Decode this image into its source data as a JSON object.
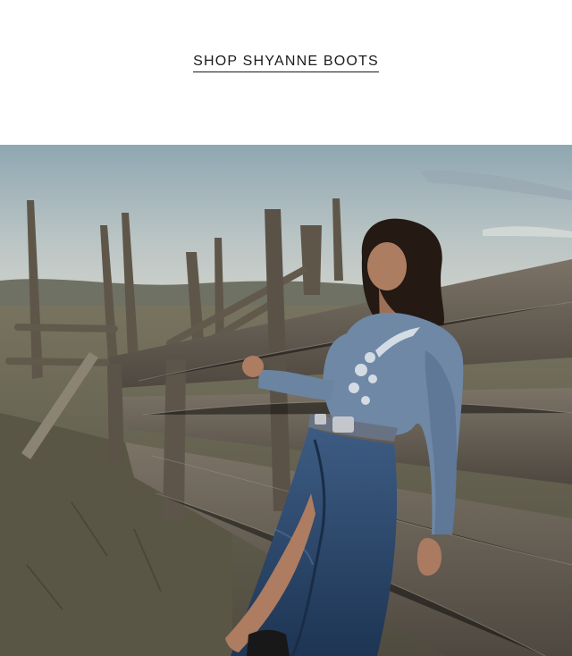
{
  "promo": {
    "cta_label": "SHOP SHYANNE BOOTS"
  },
  "hero_image": {
    "subject": "woman in denim shirt and denim skirt leaning on weathered wooden corral fence",
    "colors": {
      "sky_top": "#8fa7b2",
      "sky_bottom": "#c9d0cd",
      "ground": "#6d6a55",
      "wood": "#6f675b",
      "denim_shirt": "#6d86a3",
      "denim_skirt": "#2f4c72"
    }
  }
}
